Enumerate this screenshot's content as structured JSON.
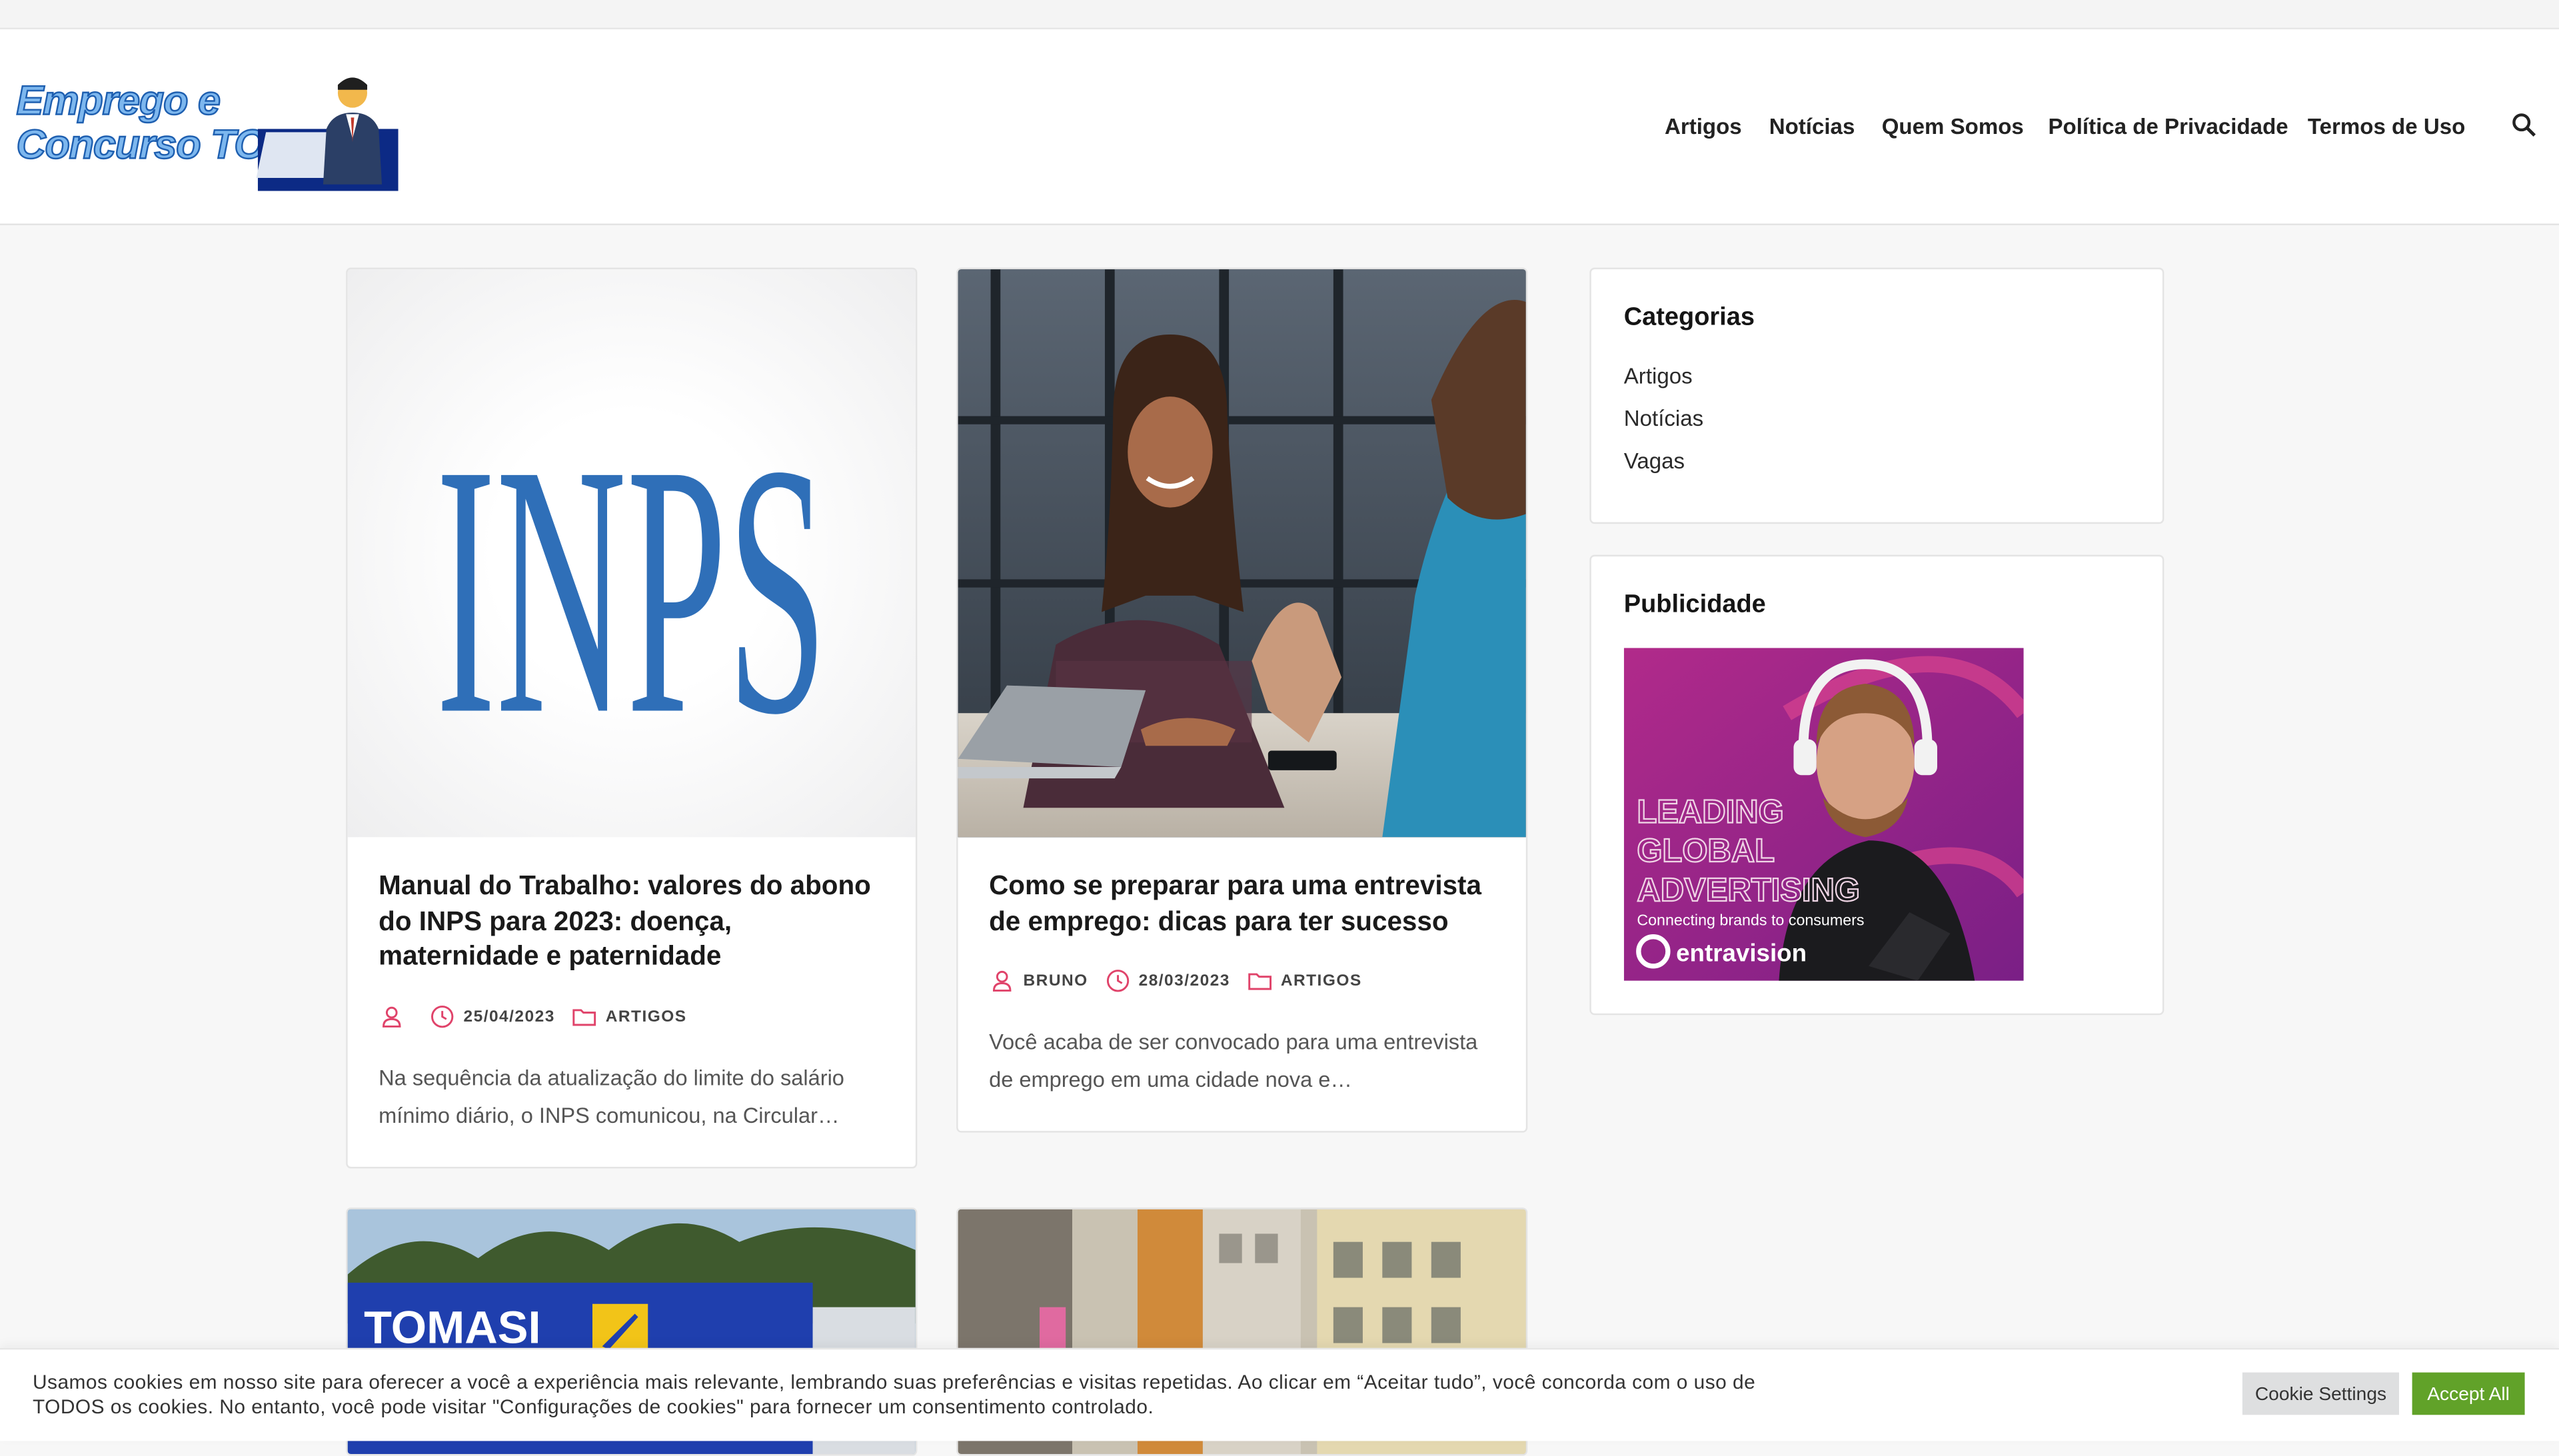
{
  "site": {
    "logo_text_line1": "Emprego e",
    "logo_text_line2": "Concurso TOP"
  },
  "nav": {
    "items": [
      {
        "label": "Artigos"
      },
      {
        "label": "Notícias"
      },
      {
        "label": "Quem Somos"
      },
      {
        "label": "Política de Privacidade"
      },
      {
        "label": "Termos de Uso"
      }
    ],
    "search_icon": "search-icon"
  },
  "posts": [
    {
      "image_text": "INPS",
      "title": "Manual do Trabalho: valores do abono do INPS para 2023: doença, maternidade e paternidade",
      "author": "",
      "date": "25/04/2023",
      "category": "ARTIGOS",
      "excerpt": "Na sequência da atualização do limite do salário mínimo diário, o INPS comunicou, na Circular…"
    },
    {
      "title": "Como se preparar para uma entrevista de emprego: dicas para ter sucesso",
      "author": "BRUNO",
      "date": "28/03/2023",
      "category": "ARTIGOS",
      "excerpt": "Você acaba de ser convocado para uma entrevista de emprego em uma cidade nova e…"
    },
    {
      "image_text": "TOMASI"
    },
    {}
  ],
  "sidebar": {
    "categories": {
      "title": "Categorias",
      "items": [
        "Artigos",
        "Notícias",
        "Vagas"
      ]
    },
    "ads": {
      "title": "Publicidade",
      "ad_line1": "LEADING",
      "ad_line2": "GLOBAL",
      "ad_line3": "ADVERTISING",
      "ad_sub": "Connecting brands to consumers",
      "ad_brand": "entravision"
    }
  },
  "cookie": {
    "text": "Usamos cookies em nosso site para oferecer a você a experiência mais relevante, lembrando suas preferências e visitas repetidas. Ao clicar em “Aceitar tudo”, você concorda com o uso de TODOS os cookies. No entanto, você pode visitar \"Configurações de cookies\" para fornecer um consentimento controlado.",
    "settings_label": "Cookie Settings",
    "accept_label": "Accept All"
  },
  "colors": {
    "accent": "#e0436a",
    "accept_green": "#61a229",
    "inps_blue": "#2f6fb8"
  }
}
